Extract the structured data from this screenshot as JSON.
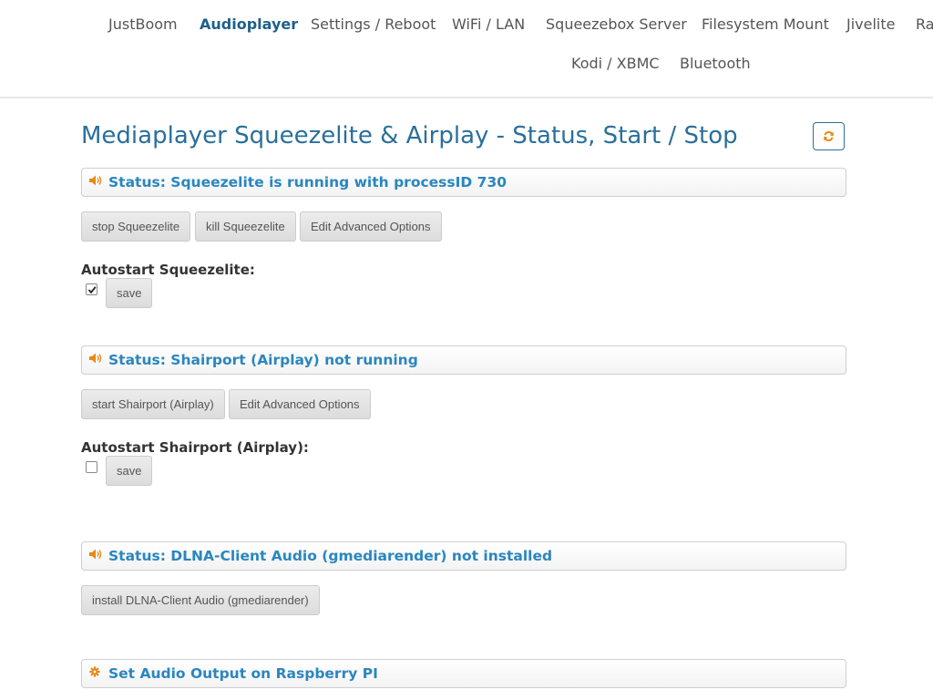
{
  "nav": {
    "items": [
      "JustBoom",
      "Audioplayer",
      "Settings / Reboot",
      "WiFi / LAN",
      "Squeezebox Server",
      "Filesystem Mount",
      "Jivelite",
      "Ra",
      "Kodi / XBMC",
      "Bluetooth"
    ],
    "active": "Audioplayer"
  },
  "page": {
    "title": "Mediaplayer Squeezelite & Airplay - Status, Start / Stop"
  },
  "squeezelite": {
    "status": "Status: Squeezelite is running with processID 730",
    "buttons": [
      "stop Squeezelite",
      "kill Squeezelite",
      "Edit Advanced Options"
    ],
    "autostart_label": "Autostart Squeezelite:",
    "autostart_checked": true,
    "save_label": "save"
  },
  "shairport": {
    "status": "Status: Shairport (Airplay) not running",
    "buttons": [
      "start Shairport (Airplay)",
      "Edit Advanced Options"
    ],
    "autostart_label": "Autostart Shairport (Airplay):",
    "autostart_checked": false,
    "save_label": "save"
  },
  "dlna": {
    "status": "Status: DLNA-Client Audio (gmediarender) not installed",
    "buttons": [
      "install DLNA-Client Audio (gmediarender)"
    ]
  },
  "audio_output": {
    "title": "Set Audio Output on Raspberry PI"
  },
  "icons": {
    "status": "speaker-icon",
    "settings": "gear-icon",
    "refresh": "refresh-icon"
  },
  "colors": {
    "accent": "#2a86bf",
    "title": "#2a6f9b",
    "nav_active": "#1f5f8b",
    "icon": "#e58a13"
  }
}
